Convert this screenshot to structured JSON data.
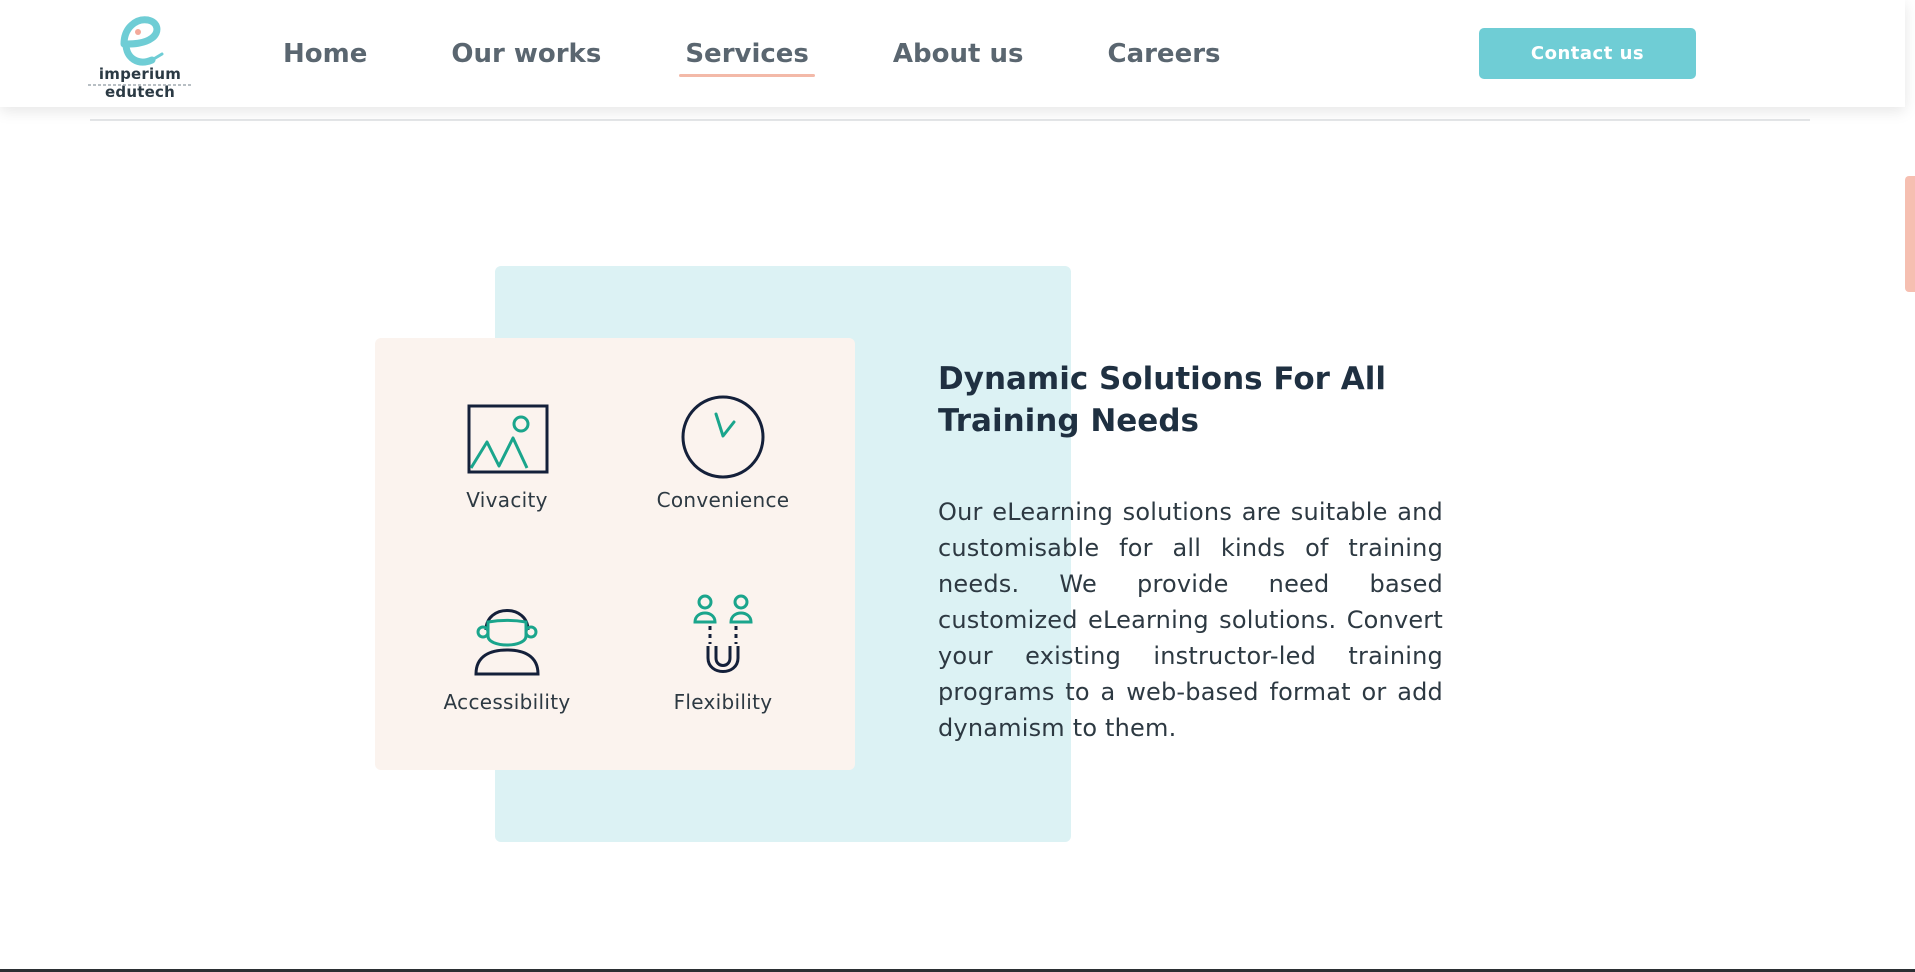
{
  "header": {
    "logo_text": "imperium edutech",
    "nav": [
      {
        "label": "Home"
      },
      {
        "label": "Our works"
      },
      {
        "label": "Services",
        "active": true
      },
      {
        "label": "About us"
      },
      {
        "label": "Careers"
      }
    ],
    "contact_label": "Contact us"
  },
  "features": [
    {
      "label": "Vivacity",
      "icon": "image-icon"
    },
    {
      "label": "Convenience",
      "icon": "clock-icon"
    },
    {
      "label": "Accessibility",
      "icon": "user-headset-icon"
    },
    {
      "label": "Flexibility",
      "icon": "magnet-people-icon"
    }
  ],
  "section": {
    "heading": "Dynamic Solutions For All Training Needs",
    "body": "Our eLearning solutions are suitable and customisable for all kinds of training needs. We provide need based customized eLearning solutions. Convert your existing instructor-led training programs to a web-based format or add dynamism to them."
  },
  "colors": {
    "accent": "#6fcdd5",
    "nav_underline": "#f3b9a8",
    "teal_block": "#dcf2f4",
    "cream_card": "#fbf3ee",
    "icon_green": "#1aa58c",
    "icon_dark": "#14203a"
  }
}
